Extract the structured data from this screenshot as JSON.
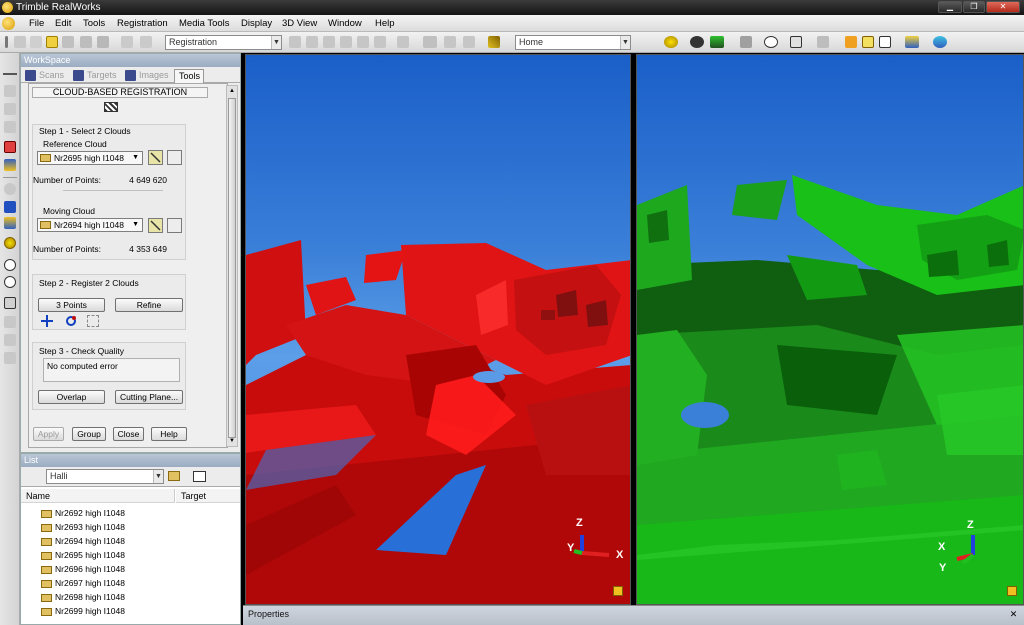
{
  "window": {
    "title": "Trimble RealWorks"
  },
  "menu": [
    "File",
    "Edit",
    "Tools",
    "Registration",
    "Media Tools",
    "Display",
    "3D View",
    "Window",
    "Help"
  ],
  "toolbar": {
    "registration_combo": "Registration",
    "view_combo": "Home"
  },
  "workspace": {
    "title": "WorkSpace",
    "tabs": [
      "Scans",
      "Targets",
      "Images",
      "Tools"
    ],
    "active_tab": "Tools",
    "tool": {
      "heading": "CLOUD-BASED REGISTRATION",
      "step1": {
        "title": "Step 1 - Select 2 Clouds",
        "reference_label": "Reference Cloud",
        "reference_value": "Nr2695 high I1048",
        "ref_points_label": "Number of Points:",
        "ref_points": "4 649 620",
        "moving_label": "Moving Cloud",
        "moving_value": "Nr2694 high I1048",
        "mov_points_label": "Number of Points:",
        "mov_points": "4 353 649"
      },
      "step2": {
        "title": "Step 2 - Register 2 Clouds",
        "btn_3points": "3 Points",
        "btn_refine": "Refine"
      },
      "step3": {
        "title": "Step 3 - Check Quality",
        "result": "No computed error",
        "btn_overlap": "Overlap",
        "btn_cutting": "Cutting Plane..."
      },
      "footer": {
        "apply": "Apply",
        "group": "Group",
        "close": "Close",
        "help": "Help"
      }
    }
  },
  "list": {
    "title": "List",
    "combo": "Halli",
    "columns": [
      "Name",
      "Target"
    ],
    "items": [
      "Nr2692 high I1048",
      "Nr2693 high I1048",
      "Nr2694 high I1048",
      "Nr2695 high I1048",
      "Nr2696 high I1048",
      "Nr2697 high I1048",
      "Nr2698 high I1048",
      "Nr2699 high I1048"
    ]
  },
  "views": {
    "left": {
      "cloud_color": "#e01010",
      "axes": {
        "z": "Z",
        "y": "Y",
        "x": "X"
      }
    },
    "right": {
      "cloud_color": "#18d018",
      "axes": {
        "z": "Z",
        "x": "X",
        "y": "Y"
      }
    }
  },
  "properties": {
    "title": "Properties"
  },
  "icons": [
    "app-icon",
    "minimize-icon",
    "restore-icon",
    "close-icon",
    "folder-icon",
    "target-icon",
    "zoom-in-icon",
    "zoom-out-icon",
    "pan-icon",
    "rotate-icon",
    "help-icon"
  ]
}
